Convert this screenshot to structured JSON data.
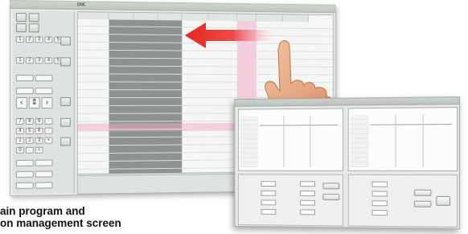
{
  "caption": {
    "line1": "ain program and",
    "line2": "on management screen"
  },
  "main_screen": {
    "title": "CNC",
    "title2": "",
    "columns": [
      "",
      "",
      "",
      "",
      "",
      "",
      "",
      ""
    ],
    "row_labels": [
      "",
      "",
      "",
      "",
      "",
      "",
      "",
      "",
      "",
      "",
      "",
      "",
      "",
      "",
      "",
      "",
      "",
      "",
      "",
      ""
    ]
  },
  "keypad": {
    "row1": [
      "1",
      "2",
      "3",
      "4",
      "5"
    ],
    "row2": [
      "1",
      "2",
      "3",
      "4",
      "5"
    ],
    "row3": [
      "7",
      "8",
      "9",
      "-"
    ],
    "row4": [
      "4",
      "5",
      "6",
      "-"
    ],
    "row5": [
      "1",
      "2",
      "3",
      "+"
    ],
    "row6": [
      "0",
      ".",
      "="
    ]
  },
  "icons": {
    "arrow": "red-arrow-icon",
    "hand": "hand-pointer-icon"
  },
  "colors": {
    "arrow": "#e8231f",
    "highlight": "#f4aac8",
    "selection": "#8f938f"
  }
}
